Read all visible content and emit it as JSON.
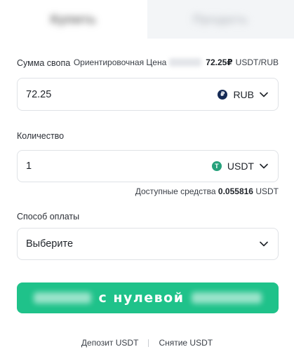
{
  "tabs": {
    "buy_label": "Купить",
    "sell_label": "Продать"
  },
  "swap": {
    "amount_label": "Сумма свопа",
    "price_label": "Ориентировочная Цена",
    "price_value": "72.25₽",
    "price_unit": "USDT/RUB",
    "amount_value": "72.25",
    "amount_currency": "RUB"
  },
  "quantity": {
    "label": "Количество",
    "value": "1",
    "currency": "USDT",
    "available_label": "Доступные средства",
    "available_value": "0.055816",
    "available_unit": "USDT"
  },
  "payment": {
    "label": "Способ оплаты",
    "selected": "Выберите"
  },
  "cta": {
    "visible_text": "с нулевой"
  },
  "footer": {
    "deposit": "Депозит USDT",
    "withdraw": "Снятие USDT"
  },
  "colors": {
    "accent": "#1fc28a",
    "rub_coin": "#152a55",
    "usdt_coin": "#26a17b"
  }
}
